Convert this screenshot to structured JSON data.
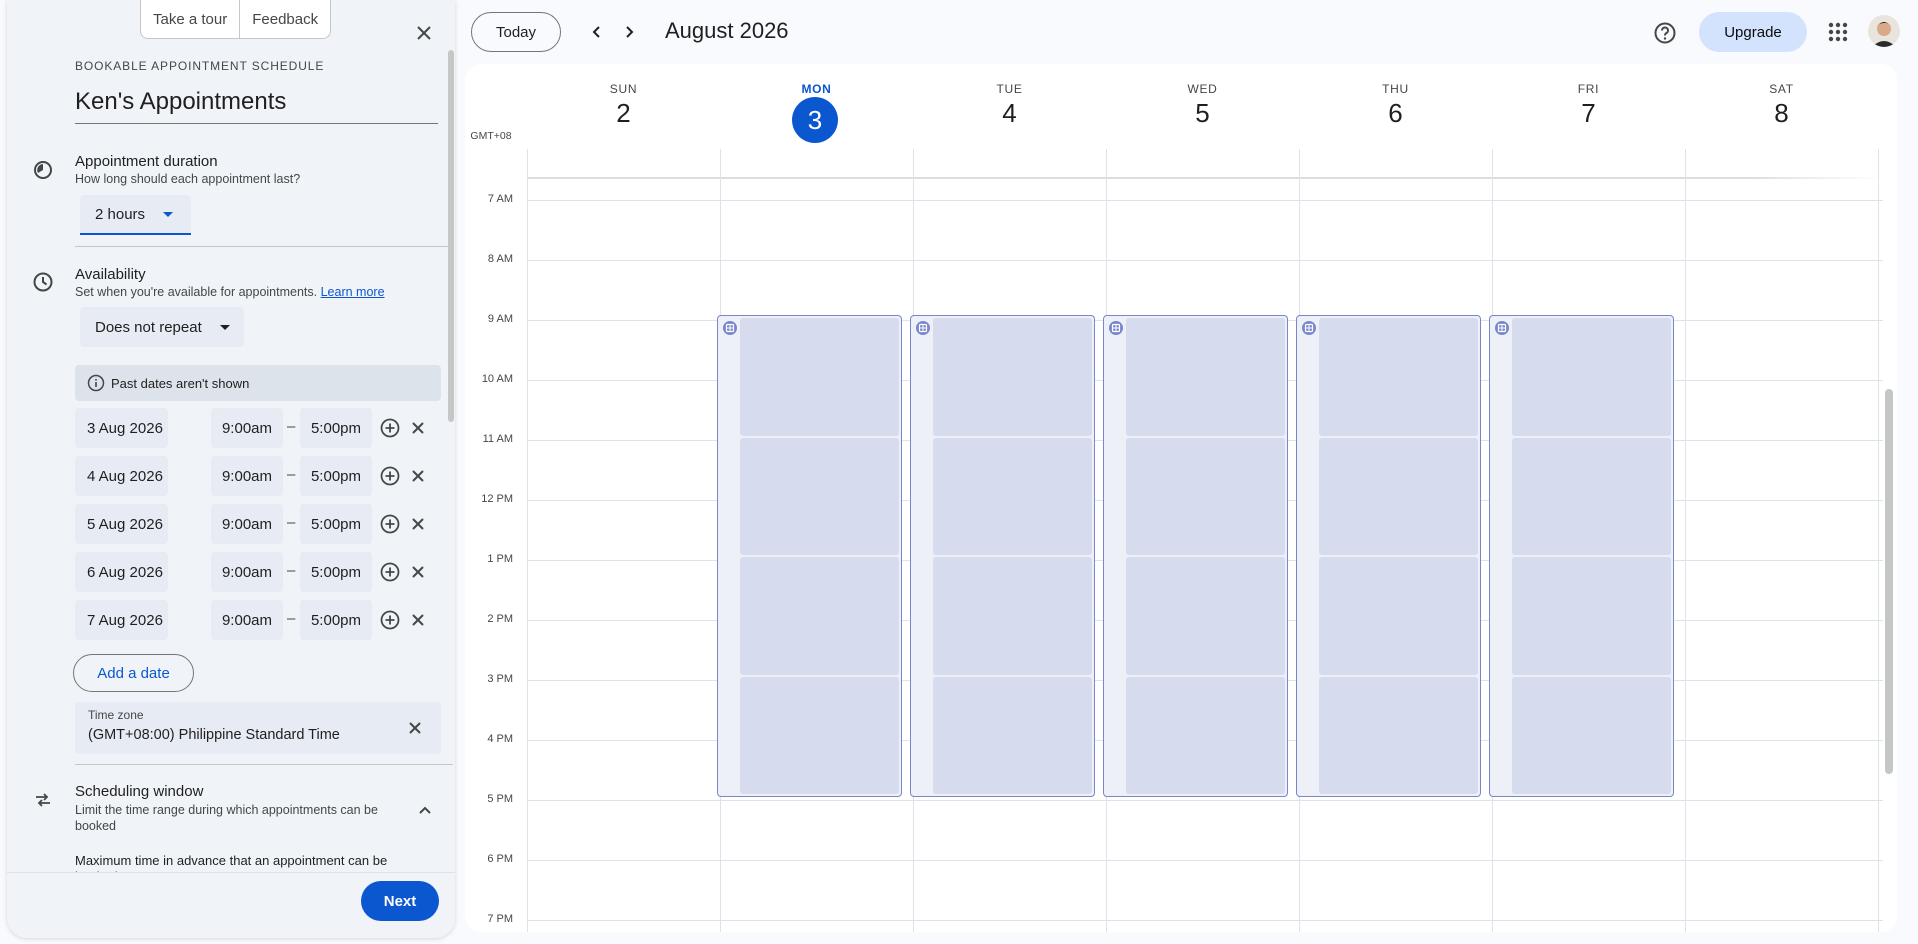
{
  "panel": {
    "tour_label": "Take a tour",
    "feedback_label": "Feedback",
    "eyebrow": "BOOKABLE APPOINTMENT SCHEDULE",
    "title": "Ken's Appointments",
    "duration": {
      "title": "Appointment duration",
      "subtitle": "How long should each appointment last?",
      "value": "2 hours"
    },
    "availability": {
      "title": "Availability",
      "subtitle": "Set when you're available for appointments.",
      "learn_more": "Learn more",
      "repeat_value": "Does not repeat",
      "notice": "Past dates aren't shown",
      "rows": [
        {
          "date": "3 Aug 2026",
          "start": "9:00am",
          "end": "5:00pm"
        },
        {
          "date": "4 Aug 2026",
          "start": "9:00am",
          "end": "5:00pm"
        },
        {
          "date": "5 Aug 2026",
          "start": "9:00am",
          "end": "5:00pm"
        },
        {
          "date": "6 Aug 2026",
          "start": "9:00am",
          "end": "5:00pm"
        },
        {
          "date": "7 Aug 2026",
          "start": "9:00am",
          "end": "5:00pm"
        }
      ],
      "dash": "–",
      "add_date": "Add a date"
    },
    "timezone": {
      "label": "Time zone",
      "value": "(GMT+08:00) Philippine Standard Time"
    },
    "scheduling_window": {
      "title": "Scheduling window",
      "subtitle": "Limit the time range during which appointments can be booked",
      "max_advance": "Maximum time in advance that an appointment can be booked"
    },
    "next_label": "Next"
  },
  "topbar": {
    "today_label": "Today",
    "month_title": "August 2026",
    "upgrade_label": "Upgrade"
  },
  "calendar": {
    "timezone_label": "GMT+08",
    "days": [
      {
        "name": "SUN",
        "date": "2"
      },
      {
        "name": "MON",
        "date": "3"
      },
      {
        "name": "TUE",
        "date": "4"
      },
      {
        "name": "WED",
        "date": "5"
      },
      {
        "name": "THU",
        "date": "6"
      },
      {
        "name": "FRI",
        "date": "7"
      },
      {
        "name": "SAT",
        "date": "8"
      }
    ],
    "hours": [
      "7 AM",
      "8 AM",
      "9 AM",
      "10 AM",
      "11 AM",
      "12 PM",
      "1 PM",
      "2 PM",
      "3 PM",
      "4 PM",
      "5 PM",
      "6 PM",
      "7 PM"
    ],
    "accent_color": "#0b57d0",
    "block_border_color": "#7986cb"
  }
}
